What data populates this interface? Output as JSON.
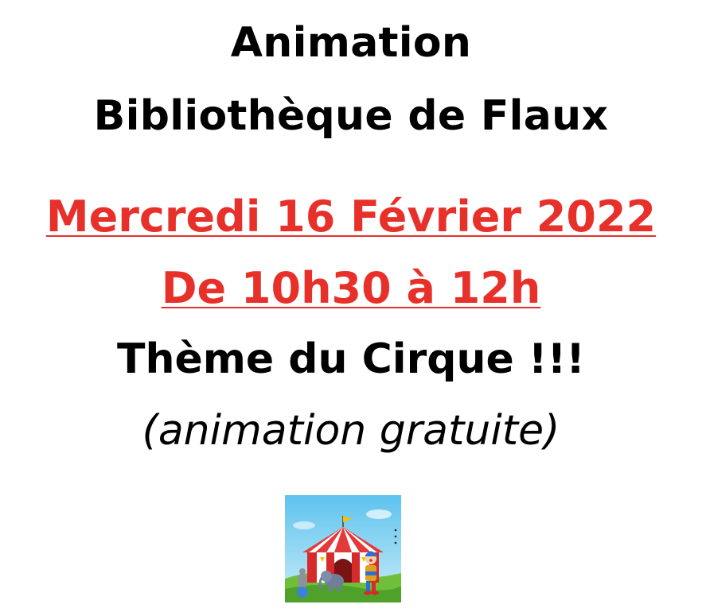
{
  "poster": {
    "heading_line1": "Animation",
    "heading_line2": "Bibliothèque de Flaux",
    "date": "Mercredi 16 Février 2022",
    "time": "De 10h30 à 12h",
    "theme": "Thème du Cirque !!!",
    "note": "(animation gratuite)"
  },
  "colors": {
    "highlight": "#e8302a",
    "text": "#000000",
    "background": "#ffffff"
  },
  "illustration": {
    "icon": "circus-tent-clown-icon"
  }
}
